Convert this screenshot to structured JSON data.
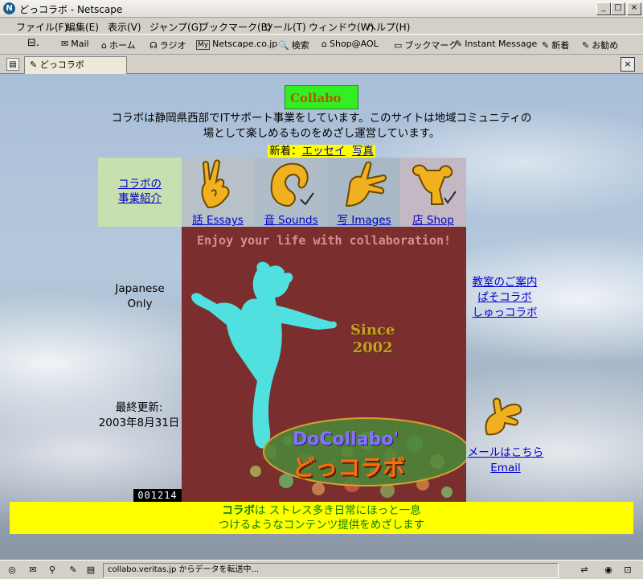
{
  "window": {
    "title": "どっコラボ - Netscape",
    "logo_letter": "N",
    "min_glyph": "_",
    "max_glyph": "□",
    "close_glyph": "×"
  },
  "menu": [
    "ファイル(F)",
    "編集(E)",
    "表示(V)",
    "ジャンプ(G)",
    "ブックマーク(B)",
    "ツール(T)",
    "ウィンドウ(W)",
    "ヘルプ(H)"
  ],
  "toolbar": {
    "items": [
      "Mail",
      "ホーム",
      "ラジオ",
      "Netscape.co.jp",
      "検索",
      "Shop@AOL",
      "ブックマーク",
      "Instant Message",
      "新着",
      "お勧め"
    ],
    "item_icons": [
      "✉",
      "⌂",
      "☊",
      "My",
      "🔍",
      "⌂",
      "▭",
      "✎",
      "✎",
      "✎"
    ]
  },
  "tab": {
    "label": "どっコラボ",
    "close_glyph": "×"
  },
  "page": {
    "logo_text": "Collabo",
    "logo_colors": {
      "bg": "#33ee22",
      "text": "#b05a00"
    },
    "description_line1": "コラボは静岡県西部でITサポート事業をしています。このサイトは地域コミュニティの",
    "description_line2": "場として楽しめるものをめざし運営しています。",
    "news_label": "新着：",
    "news_link1": "エッセイ",
    "news_link2": "写真",
    "nav_intro_line1": "コラボの",
    "nav_intro_line2": "事業紹介",
    "nav_items": [
      {
        "label": "話 Essays",
        "bg": "#b8c0c8"
      },
      {
        "label": "音 Sounds",
        "bg": "#b0bcc8"
      },
      {
        "label": "写 Images",
        "bg": "#a8b8c4"
      },
      {
        "label": "店 Shop",
        "bg": "#c4b8c4"
      }
    ],
    "nav_intro_bg": "#c8e0b0",
    "enjoy_text": "Enjoy your life with collaboration!",
    "since_line1": "Since",
    "since_line2": "2002",
    "docollabo_en": "DoCollabo'",
    "docollabo_jp": "どっコラボ",
    "japanese_only_line1": "Japanese",
    "japanese_only_line2": "Only",
    "updated_label": "最終更新:",
    "updated_date": "2003年8月31日",
    "counter": "001214",
    "right_links": [
      "教室のご案内",
      "ぱそコラボ",
      "しゅっコラボ"
    ],
    "mail_link1": "メールはこちら",
    "mail_link2": "Email",
    "banner_strong": "コラボ",
    "banner_line1_rest": "は ストレス多き日常にほっと一息",
    "banner_line2": "つけるようなコンテンツ提供をめざします",
    "colors": {
      "main_panel": "#7a2e2e",
      "figure": "#50e0e0",
      "banner_bg": "#ffff00",
      "banner_text": "#008000"
    }
  },
  "status": {
    "text": "collabo.veritas.jp からデータを転送中..."
  }
}
